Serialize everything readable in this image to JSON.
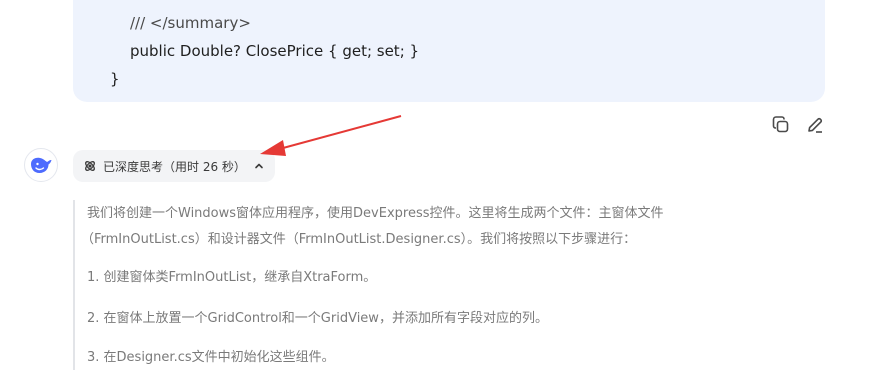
{
  "code": {
    "lines": [
      "/// </summary>",
      "public Double? ClosePrice { get; set; }",
      "}"
    ]
  },
  "actions": {
    "copy_icon": "copy-icon",
    "edit_icon": "edit-icon"
  },
  "thinking": {
    "pill_label": "已深度思考（用时 26 秒）",
    "paragraphs": [
      "我们将创建一个Windows窗体应用程序，使用DevExpress控件。这里将生成两个文件：主窗体文件",
      "（FrmInOutList.cs）和设计器文件（FrmInOutList.Designer.cs）。我们将按照以下步骤进行：",
      "1. 创建窗体类FrmInOutList，继承自XtraForm。",
      "2. 在窗体上放置一个GridControl和一个GridView，并添加所有字段对应的列。",
      "3. 在Designer.cs文件中初始化这些组件。"
    ]
  },
  "colors": {
    "code_bg": "#eef3fd",
    "arrow": "#e53935",
    "logo_blue": "#4d6bfe"
  }
}
